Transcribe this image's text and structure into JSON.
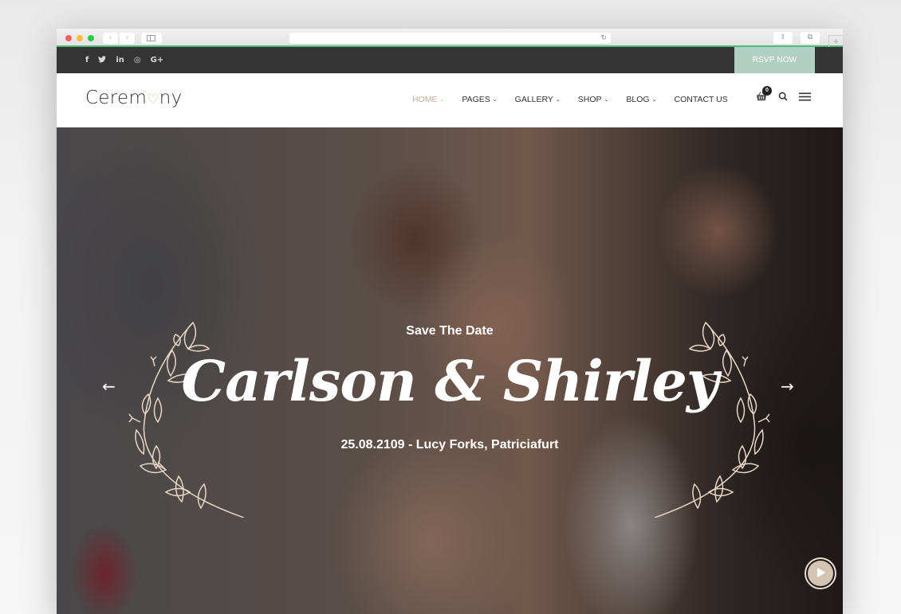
{
  "browser": {
    "traffic_lights": [
      "#fc605c",
      "#fdbc40",
      "#34c84a"
    ],
    "back_icon": "‹",
    "forward_icon": "›",
    "reload_icon": "↻",
    "share_icon": "⇪",
    "tabs_icon": "⧉",
    "new_tab_icon": "+"
  },
  "topbar": {
    "social": [
      {
        "name": "facebook",
        "glyph": "f"
      },
      {
        "name": "twitter",
        "glyph": "t"
      },
      {
        "name": "linkedin",
        "glyph": "in"
      },
      {
        "name": "instagram",
        "glyph": "◎"
      },
      {
        "name": "google-plus",
        "glyph": "G+"
      }
    ],
    "rsvp_label": "RSVP NOW",
    "rsvp_color": "#b1d0c3"
  },
  "header": {
    "logo_left": "Cerem",
    "logo_heart": "♡",
    "logo_right": "ny",
    "nav": [
      {
        "label": "HOME",
        "dropdown": true,
        "active": true
      },
      {
        "label": "PAGES",
        "dropdown": true,
        "active": false
      },
      {
        "label": "GALLERY",
        "dropdown": true,
        "active": false
      },
      {
        "label": "SHOP",
        "dropdown": true,
        "active": false
      },
      {
        "label": "BLOG",
        "dropdown": true,
        "active": false
      },
      {
        "label": "CONTACT US",
        "dropdown": false,
        "active": false
      }
    ],
    "chevron": "⌄",
    "cart_count": "0",
    "accent_color": "#c9ab98"
  },
  "hero": {
    "eyebrow": "Save The Date",
    "names": "Carlson & Shirley",
    "details": "25.08.2109 - Lucy Forks, Patriciafurt",
    "prev_arrow": "←",
    "next_arrow": "→"
  }
}
